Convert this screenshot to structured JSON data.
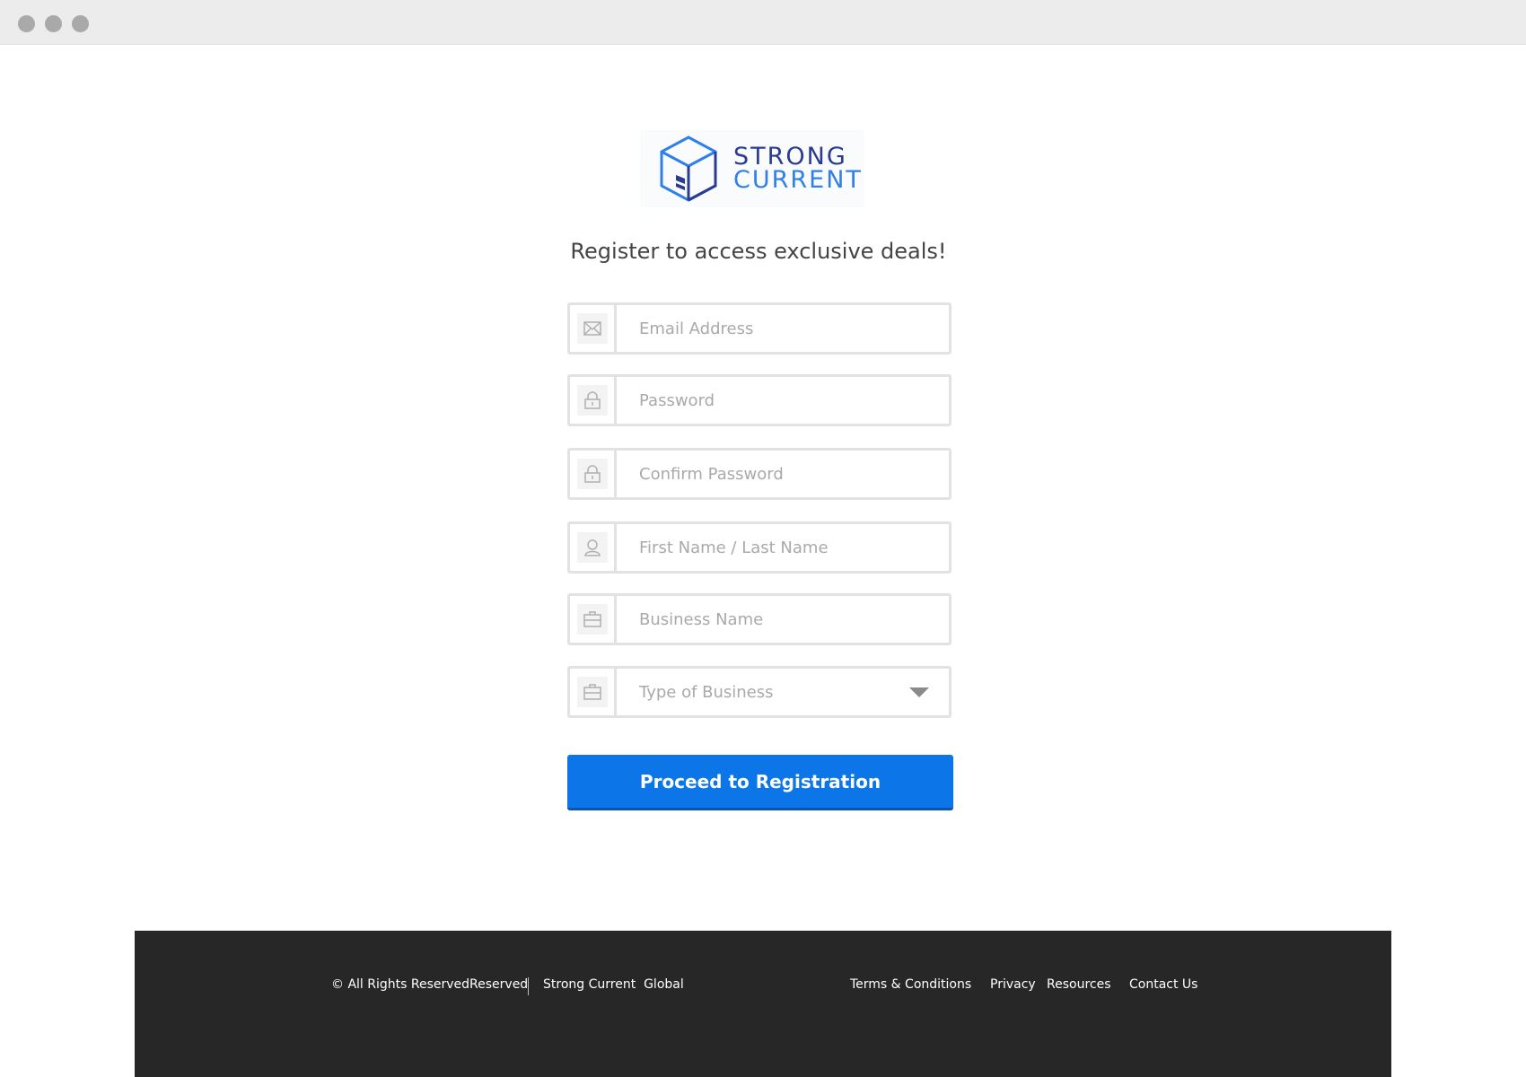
{
  "window": {
    "controls": [
      "window-dot",
      "window-dot",
      "window-dot"
    ]
  },
  "brand": {
    "line1": "STRONG",
    "line2": "CURRENT",
    "colors": {
      "dark": "#2a3b92",
      "light": "#2f80e8"
    }
  },
  "heading": "Register to access exclusive deals!",
  "form": {
    "email": {
      "placeholder": "Email Address",
      "icon": "envelope-icon"
    },
    "password": {
      "placeholder": "Password",
      "icon": "lock-icon"
    },
    "confirm_password": {
      "placeholder": "Confirm Password",
      "icon": "lock-icon"
    },
    "name": {
      "placeholder": "First Name / Last Name",
      "icon": "user-icon"
    },
    "business_name": {
      "placeholder": "Business Name",
      "icon": "briefcase-icon"
    },
    "business_type": {
      "selected": "Type of Business",
      "icon": "briefcase-icon"
    },
    "submit_label": "Proceed to Registration"
  },
  "footer": {
    "copyright": "© All Rights ReservedReserved",
    "company": "Strong Current  Global",
    "links": {
      "terms": "Terms & Conditions",
      "privacy": "Privacy",
      "resources": "Resources",
      "contact": "Contact Us"
    }
  },
  "colors": {
    "primary_button": "#0c76e8",
    "footer_bg": "#272727",
    "field_border": "#e2e2e2"
  }
}
